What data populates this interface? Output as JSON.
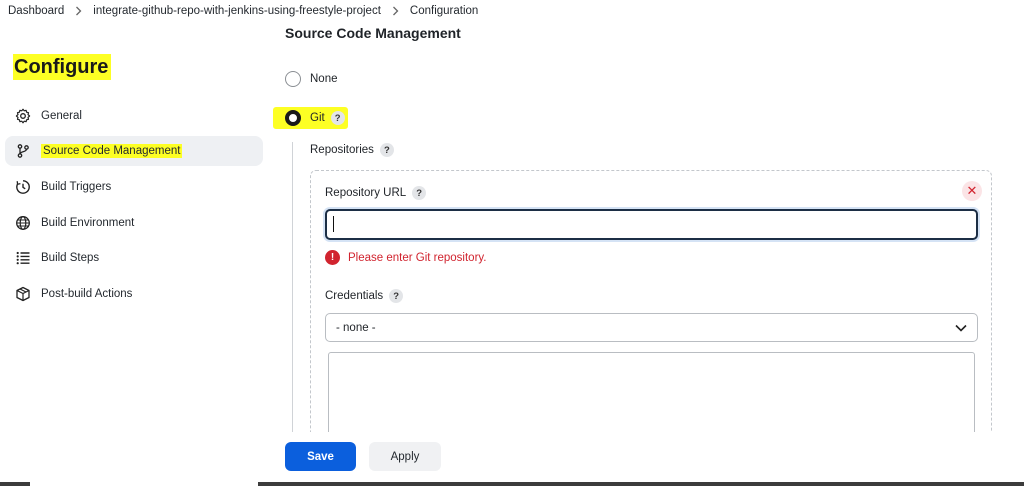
{
  "breadcrumb": {
    "items": [
      "Dashboard",
      "integrate-github-repo-with-jenkins-using-freestyle-project",
      "Configuration"
    ]
  },
  "sidebar": {
    "title": "Configure",
    "items": [
      {
        "label": "General",
        "icon": "gear-icon"
      },
      {
        "label": "Source Code Management",
        "icon": "branch-icon"
      },
      {
        "label": "Build Triggers",
        "icon": "clock-icon"
      },
      {
        "label": "Build Environment",
        "icon": "globe-icon"
      },
      {
        "label": "Build Steps",
        "icon": "list-icon"
      },
      {
        "label": "Post-build Actions",
        "icon": "package-icon"
      }
    ]
  },
  "main": {
    "section_title": "Source Code Management",
    "scm_options": [
      {
        "label": "None",
        "selected": false
      },
      {
        "label": "Git",
        "selected": true
      }
    ],
    "repositories_label": "Repositories",
    "repository_url_label": "Repository URL",
    "repository_url_value": "",
    "error_message": "Please enter Git repository.",
    "credentials_label": "Credentials",
    "credentials_selected": "- none -"
  },
  "actions": {
    "save_label": "Save",
    "apply_label": "Apply"
  },
  "colors": {
    "highlight": "#fdff24",
    "primary": "#0b5fdd",
    "error": "#d1242f"
  }
}
